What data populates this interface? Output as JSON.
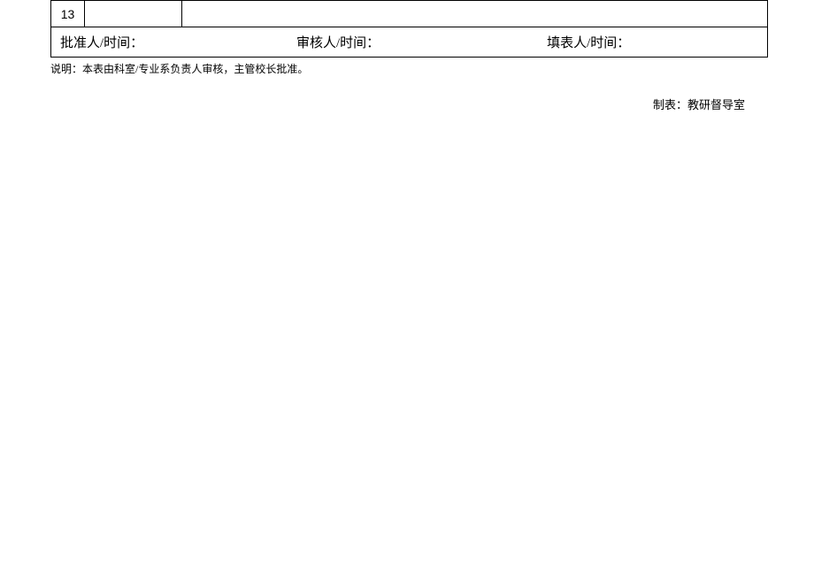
{
  "table": {
    "row_number": "13"
  },
  "signatures": {
    "approver": "批准人/时间：",
    "reviewer": "审核人/时间：",
    "preparer": "填表人/时间："
  },
  "note": "说明：本表由科室/专业系负责人审核，主管校长批准。",
  "footer": "制表：教研督导室"
}
